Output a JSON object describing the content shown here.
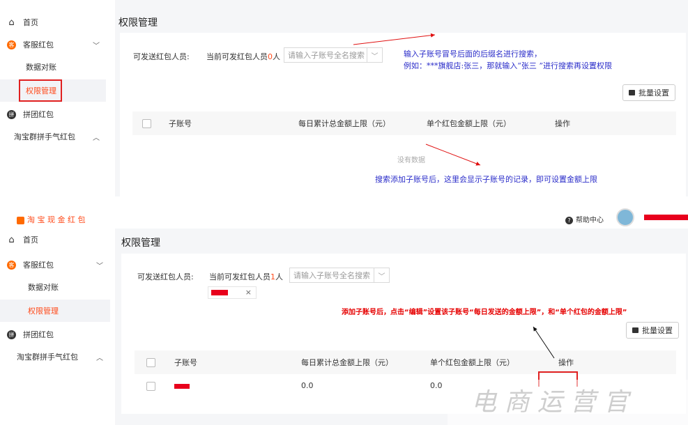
{
  "sidebar_nav": {
    "home": "首页",
    "service_redpack": "客服红包",
    "reconciliation": "数据对账",
    "permission": "权限管理",
    "group_redpack": "拼团红包",
    "taobao_group": "淘宝群拼手气红包"
  },
  "top_panel": {
    "title": "权限管理",
    "sendable_label": "可发送红包人员:",
    "current_prefix": "当前可发红包人员",
    "current_count": "0",
    "current_suffix": "人",
    "search_placeholder": "请输入子账号全名搜索",
    "batch_button": "批量设置",
    "col_subaccount": "子账号",
    "col_daily_limit": "每日累计总金额上限（元）",
    "col_single_limit": "单个红包金额上限（元）",
    "col_actions": "操作",
    "empty_text": "没有数据",
    "annotation_line1": "输入子账号冒号后面的后缀名进行搜索，",
    "annotation_line2": "例如：***旗舰店:张三，那就输入“张三 ”进行搜索再设置权限",
    "annotation_bottom": "搜索添加子账号后，这里会显示子账号的记录，即可设置金额上限"
  },
  "bottom_panel": {
    "brand": "淘 宝 现 金 红 包",
    "help_center": "帮助中心",
    "title": "权限管理",
    "sendable_label": "可发送红包人员:",
    "current_prefix": "当前可发红包人员",
    "current_count": "1",
    "current_suffix": "人",
    "search_placeholder": "请输入子账号全名搜索",
    "tag_close": "×",
    "batch_button": "批量设置",
    "annotation": "添加子账号后，点击“编辑”设置该子账号“每日发送的金额上限”，和“单个红包的金额上限”",
    "col_subaccount": "子账号",
    "col_daily_limit": "每日累计总金额上限（元）",
    "col_single_limit": "单个红包金额上限（元）",
    "col_actions": "操作",
    "row": {
      "daily_limit": "0.0",
      "single_limit": "0.0"
    }
  },
  "watermark": "电 商 运 营 官",
  "colors": {
    "accent": "#ff4a1a",
    "annotation_blue": "#2a2cc9",
    "annotation_red": "#e60000",
    "redaction": "#e8001c"
  }
}
